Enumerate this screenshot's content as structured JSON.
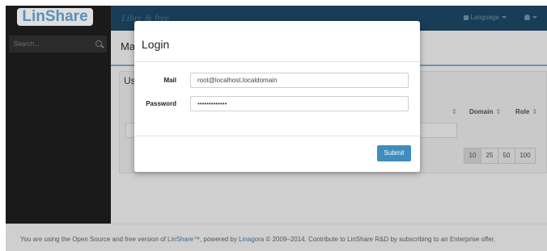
{
  "app": {
    "logo_text": "LinShare",
    "tagline": "Libre & free"
  },
  "sidebar": {
    "search_placeholder": "Search..."
  },
  "topbar": {
    "language_label": "Language"
  },
  "main": {
    "title_partial": "Ma",
    "panel_title_partial": "Us",
    "columns": [
      {
        "label": "Domain",
        "sort": "⇕"
      },
      {
        "label": "Role",
        "sort": "⇕"
      }
    ],
    "extra_sort": "⇕",
    "page_sizes": [
      "10",
      "25",
      "50",
      "100"
    ]
  },
  "modal": {
    "title": "Login",
    "mail_label": "Mail",
    "mail_value": "root@localhost.localdomain",
    "password_label": "Password",
    "password_value": "•••••••••••••",
    "submit_label": "Submit"
  },
  "footer": {
    "prefix": "You are using the Open Source and free version of ",
    "brand": "LinShare™",
    "middle": ", powered by ",
    "company": "Linagora",
    "suffix": " © 2009–2014. Contribute to LinShare R&D by subscribing to an Enterprise offer."
  },
  "colors": {
    "accent": "#3e8dbe",
    "topbar": "#1a3d57",
    "sidebar": "#1a1a1a"
  }
}
